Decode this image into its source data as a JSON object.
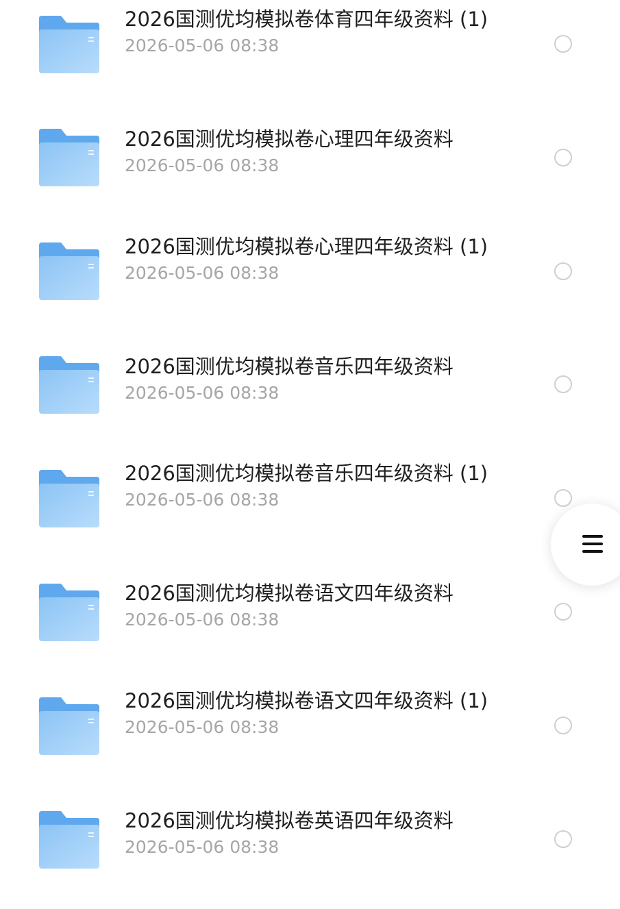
{
  "file_list": {
    "items": [
      {
        "title": "2026国测优均模拟卷体育四年级资料 (1)",
        "date": "2026-05-06 08:38",
        "icon": "folder-icon"
      },
      {
        "title": "2026国测优均模拟卷心理四年级资料",
        "date": "2026-05-06 08:38",
        "icon": "folder-icon"
      },
      {
        "title": "2026国测优均模拟卷心理四年级资料 (1)",
        "date": "2026-05-06 08:38",
        "icon": "folder-icon"
      },
      {
        "title": "2026国测优均模拟卷音乐四年级资料",
        "date": "2026-05-06 08:38",
        "icon": "folder-icon"
      },
      {
        "title": "2026国测优均模拟卷音乐四年级资料 (1)",
        "date": "2026-05-06 08:38",
        "icon": "folder-icon"
      },
      {
        "title": "2026国测优均模拟卷语文四年级资料",
        "date": "2026-05-06 08:38",
        "icon": "folder-icon"
      },
      {
        "title": "2026国测优均模拟卷语文四年级资料 (1)",
        "date": "2026-05-06 08:38",
        "icon": "folder-icon"
      },
      {
        "title": "2026国测优均模拟卷英语四年级资料",
        "date": "2026-05-06 08:38",
        "icon": "folder-icon"
      }
    ]
  },
  "floating_menu": {
    "icon": "menu-icon"
  },
  "colors": {
    "folder_light": "#a9d3f8",
    "folder_dark": "#5fa8ee",
    "title_text": "#1f1f1f",
    "date_text": "#a6a6a6",
    "radio_border": "#cfcfcf"
  }
}
